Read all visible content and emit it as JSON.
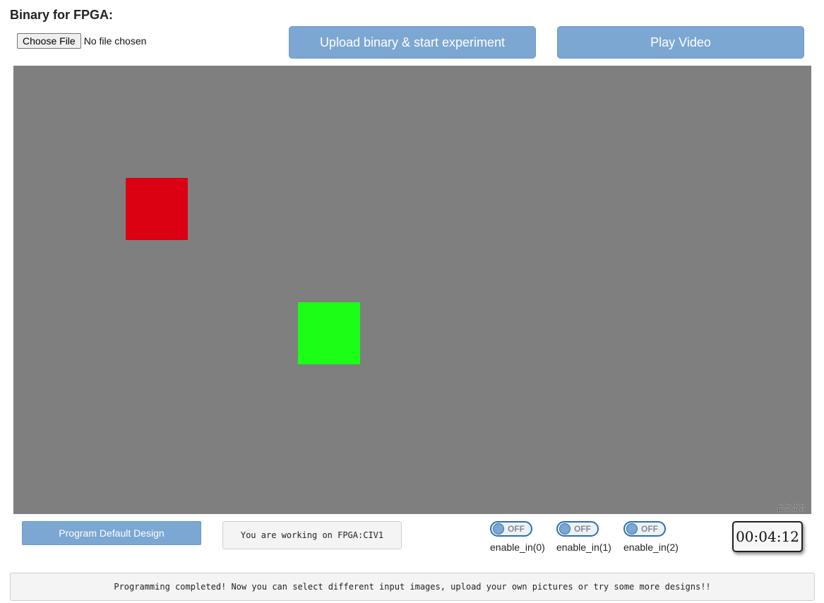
{
  "header": {
    "title": "Binary for FPGA:"
  },
  "file_picker": {
    "button_label": "Choose File",
    "status": "No file chosen"
  },
  "actions": {
    "upload_label": "Upload binary & start experiment",
    "play_label": "Play Video"
  },
  "video": {
    "background_color": "#7f7f80",
    "objects": [
      {
        "name": "red-square",
        "color": "#dc0013"
      },
      {
        "name": "green-square",
        "color": "#1bff17"
      }
    ],
    "timestamp_line1": "2025-06-05",
    "timestamp_line2": "11:58:36.00"
  },
  "controls": {
    "program_default_label": "Program Default Design",
    "fpga_info": "You are working on FPGA:CIV1",
    "toggles": [
      {
        "state": "OFF",
        "label": "enable_in(0)"
      },
      {
        "state": "OFF",
        "label": "enable_in(1)"
      },
      {
        "state": "OFF",
        "label": "enable_in(2)"
      }
    ],
    "timer": "00:04:12"
  },
  "status": {
    "message": "Programming completed! Now you can select different input images, upload your own pictures or try some more designs!!"
  },
  "colors": {
    "accent": "#7ba7d2",
    "toggle_border": "#2f6fb0"
  }
}
